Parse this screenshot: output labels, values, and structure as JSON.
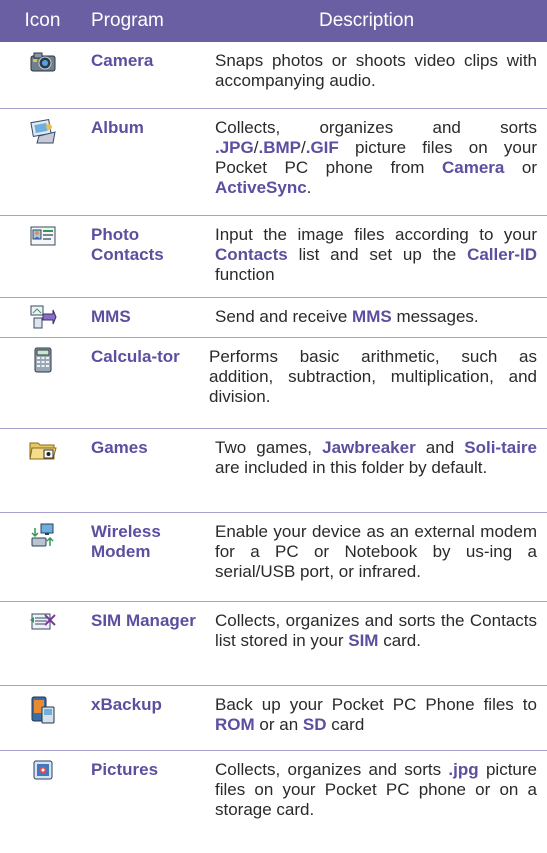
{
  "header": {
    "icon": "Icon",
    "program": "Program",
    "description": "Description"
  },
  "rows": [
    {
      "icon": "camera-icon",
      "program": "Camera",
      "description": [
        {
          "t": "Snaps photos or shoots video clips with accompanying audio."
        }
      ]
    },
    {
      "icon": "album-icon",
      "program": "Album",
      "description": [
        {
          "t": "Collects, organizes and sorts "
        },
        {
          "t": ".JPG",
          "h": true
        },
        {
          "t": "/"
        },
        {
          "t": ".BMP",
          "h": true
        },
        {
          "t": "/"
        },
        {
          "t": ".GIF",
          "h": true
        },
        {
          "t": " picture files on your Pocket PC phone from "
        },
        {
          "t": "Camera",
          "h": true
        },
        {
          "t": " or "
        },
        {
          "t": "ActiveSync",
          "h": true
        },
        {
          "t": "."
        }
      ]
    },
    {
      "icon": "photo-contacts-icon",
      "program": "Photo Contacts",
      "description": [
        {
          "t": "Input the image files according to your "
        },
        {
          "t": "Contacts",
          "h": true
        },
        {
          "t": " list and set up the "
        },
        {
          "t": "Caller-ID",
          "h": true
        },
        {
          "t": " function"
        }
      ]
    },
    {
      "icon": "mms-icon",
      "program": "MMS",
      "description": [
        {
          "t": "Send and receive "
        },
        {
          "t": "MMS",
          "h": true
        },
        {
          "t": " messages."
        }
      ]
    },
    {
      "icon": "calculator-icon",
      "program": "Calcula-tor",
      "description": [
        {
          "t": "Performs basic arithmetic, such as addition, subtraction, multiplication, and division."
        }
      ]
    },
    {
      "icon": "games-folder-icon",
      "program": "Games",
      "description": [
        {
          "t": "Two games, "
        },
        {
          "t": "Jawbreaker",
          "h": true
        },
        {
          "t": " and "
        },
        {
          "t": "Soli-taire",
          "h": true
        },
        {
          "t": " are included in this folder by default."
        }
      ]
    },
    {
      "icon": "wireless-modem-icon",
      "program": "Wireless Modem",
      "description": [
        {
          "t": "Enable your device as an external modem for a PC or Notebook by us-ing a serial/USB port, or infrared."
        }
      ]
    },
    {
      "icon": "sim-manager-icon",
      "program": "SIM Manager",
      "description": [
        {
          "t": "Collects, organizes and sorts the Contacts list stored in your "
        },
        {
          "t": "SIM",
          "h": true
        },
        {
          "t": " card."
        }
      ]
    },
    {
      "icon": "xbackup-icon",
      "program": "xBackup",
      "description": [
        {
          "t": "Back up your Pocket PC Phone files to "
        },
        {
          "t": "ROM",
          "h": true
        },
        {
          "t": " or an "
        },
        {
          "t": "SD",
          "h": true
        },
        {
          "t": " card"
        }
      ]
    },
    {
      "icon": "pictures-icon",
      "program": "Pictures",
      "description": [
        {
          "t": "Collects, organizes and sorts "
        },
        {
          "t": ".jpg",
          "h": true
        },
        {
          "t": " picture files on your Pocket PC phone or on a storage card."
        }
      ]
    }
  ]
}
